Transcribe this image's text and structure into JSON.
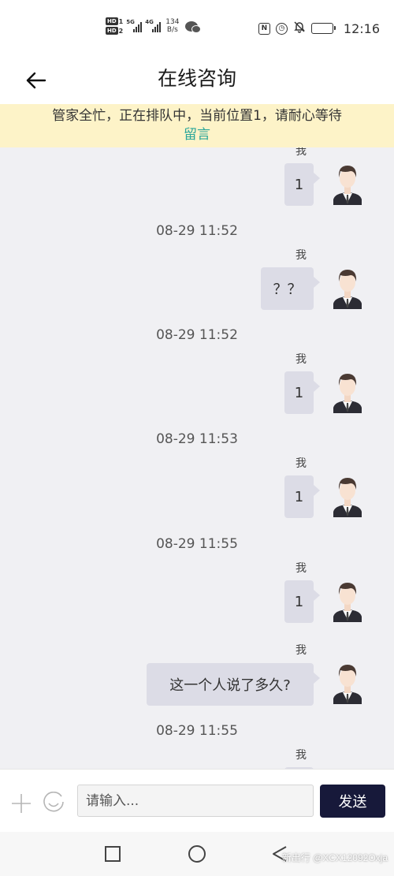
{
  "status_bar": {
    "hd_badges": [
      {
        "label": "HD",
        "num": "1"
      },
      {
        "label": "HD",
        "num": "2"
      }
    ],
    "signal_labels": [
      "5G",
      "4G"
    ],
    "net_speed_value": "134",
    "net_speed_unit": "B/s",
    "nfc_icon": "nfc-icon",
    "alarm_icon": "alarm-icon",
    "mute_icon": "bell-off-icon",
    "battery_icon": "battery-icon",
    "time": "12:16"
  },
  "header": {
    "back_icon": "arrow-left-icon",
    "title": "在线咨询"
  },
  "notice": {
    "text": "管家全忙，正在排队中，当前位置1，请耐心等待",
    "link": "留言",
    "bg_color": "#fdf3c8",
    "link_color": "#2aa69a"
  },
  "chat": {
    "messages": [
      {
        "timestamp": "",
        "sender": "我",
        "text": "1"
      },
      {
        "timestamp": "08-29 11:52",
        "sender": "我",
        "text": "？？"
      },
      {
        "timestamp": "08-29 11:52",
        "sender": "我",
        "text": "1"
      },
      {
        "timestamp": "08-29 11:53",
        "sender": "我",
        "text": "1"
      },
      {
        "timestamp": "08-29 11:55",
        "sender": "我",
        "text": "1"
      },
      {
        "timestamp": "",
        "sender": "我",
        "text": "这一个人说了多久?"
      },
      {
        "timestamp": "08-29 11:55",
        "sender": "我",
        "text": ""
      }
    ],
    "bubble_color": "#dcdce6"
  },
  "input_bar": {
    "plus_icon": "plus-icon",
    "emoji_icon": "emoji-icon",
    "placeholder": "请输入...",
    "send_label": "发送",
    "send_color": "#17193a"
  },
  "nav_bar": {
    "square_icon": "recent-apps-icon",
    "circle_icon": "home-icon",
    "triangle_icon": "back-triangle-icon",
    "watermark": "新出行 @XCX12092Oxja"
  }
}
